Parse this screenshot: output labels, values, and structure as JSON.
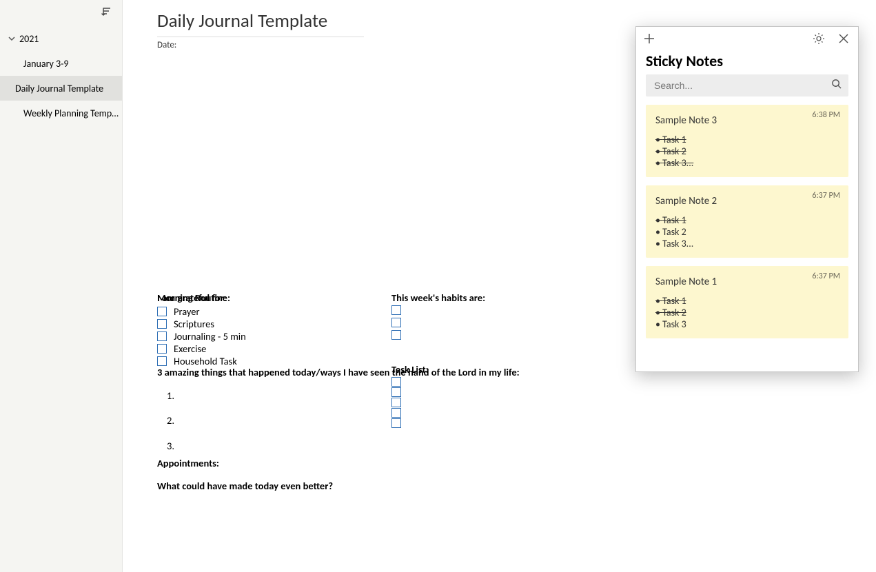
{
  "sidebar": {
    "year": "2021",
    "items": [
      {
        "label": "January 3-9"
      },
      {
        "label": "Daily Journal Template",
        "selected": true
      },
      {
        "label": "Weekly Planning Templ…"
      }
    ]
  },
  "page": {
    "title": "Daily Journal Template",
    "date_label": "Date:",
    "morning_title": "Morning  Routine:",
    "morning_items": [
      "Prayer",
      "Scriptures",
      "Journaling - 5 min",
      "Exercise",
      "Household Task"
    ],
    "habits_title": "This week's habits are:",
    "habits_count": 3,
    "appointments_title": "Appointments:",
    "tasklist_title": "Task List:",
    "tasklist_count": 5,
    "grateful_title": "I am grateful for:",
    "amazing_title": "3 amazing things that happened today/ways I have seen the hand of the Lord in my life:",
    "amazing_numbers": [
      "1.",
      "2.",
      "3."
    ],
    "better_title": "What could have made today even better?"
  },
  "sticky": {
    "title": "Sticky Notes",
    "search_placeholder": "Search...",
    "notes": [
      {
        "time": "6:38 PM",
        "title": "Sample Note 3",
        "items": [
          {
            "text": "Task 1",
            "struck": true
          },
          {
            "text": "Task 2",
            "struck": true
          },
          {
            "text": "Task 3...",
            "struck": true
          }
        ]
      },
      {
        "time": "6:37 PM",
        "title": "Sample Note 2",
        "items": [
          {
            "text": "Task 1",
            "struck": true
          },
          {
            "text": "Task 2",
            "struck": false
          },
          {
            "text": "Task 3...",
            "struck": false
          }
        ]
      },
      {
        "time": "6:37 PM",
        "title": "Sample Note 1",
        "items": [
          {
            "text": "Task 1",
            "struck": true
          },
          {
            "text": "Task 2",
            "struck": true
          },
          {
            "text": "Task 3",
            "struck": false
          }
        ]
      }
    ]
  }
}
